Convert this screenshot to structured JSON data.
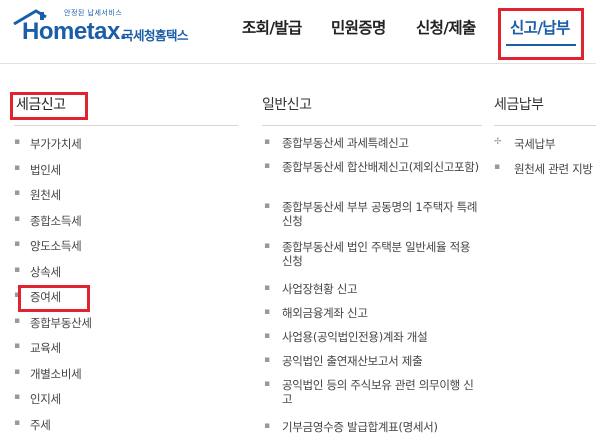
{
  "logo": {
    "tagline": "안정된 납세서비스",
    "brand": "Hometax.",
    "korean_name": "국세청홈택스"
  },
  "topnav": [
    {
      "label": "조회/발급"
    },
    {
      "label": "민원증명"
    },
    {
      "label": "신청/제출"
    },
    {
      "label": "신고/납부",
      "active": true
    }
  ],
  "columns": {
    "tax_filing": {
      "title": "세금신고",
      "items": [
        "부가가치세",
        "법인세",
        "원천세",
        "종합소득세",
        "양도소득세",
        "상속세",
        "증여세",
        "종합부동산세",
        "교육세",
        "개별소비세",
        "인지세",
        "주세"
      ]
    },
    "general_filing": {
      "title": "일반신고",
      "items": [
        "종합부동산세 과세특례신고",
        "종합부동산세 합산배제신고(제외신고포함)",
        "종합부동산세 부부 공동명의 1주택자 특례 신청",
        "종합부동산세 법인 주택분 일반세율 적용 신청",
        "사업장현황 신고",
        "해외금융계좌 신고",
        "사업용(공익법인전용)계좌 개설",
        "공익법인 출연재산보고서 제출",
        "공익법인 등의 주식보유 관련 의무이행 신고",
        "기부금영수증 발급합계표(명세서)"
      ]
    },
    "tax_payment": {
      "title": "세금납부",
      "items": [
        "국세납부",
        "원천세 관련 지방"
      ]
    }
  },
  "colors": {
    "brand_blue": "#1a5ea8",
    "highlight_red": "#e0242f"
  },
  "icons": {
    "item_bullet": "square-bullet-icon",
    "payment_bullet": "plus-small-icon"
  }
}
